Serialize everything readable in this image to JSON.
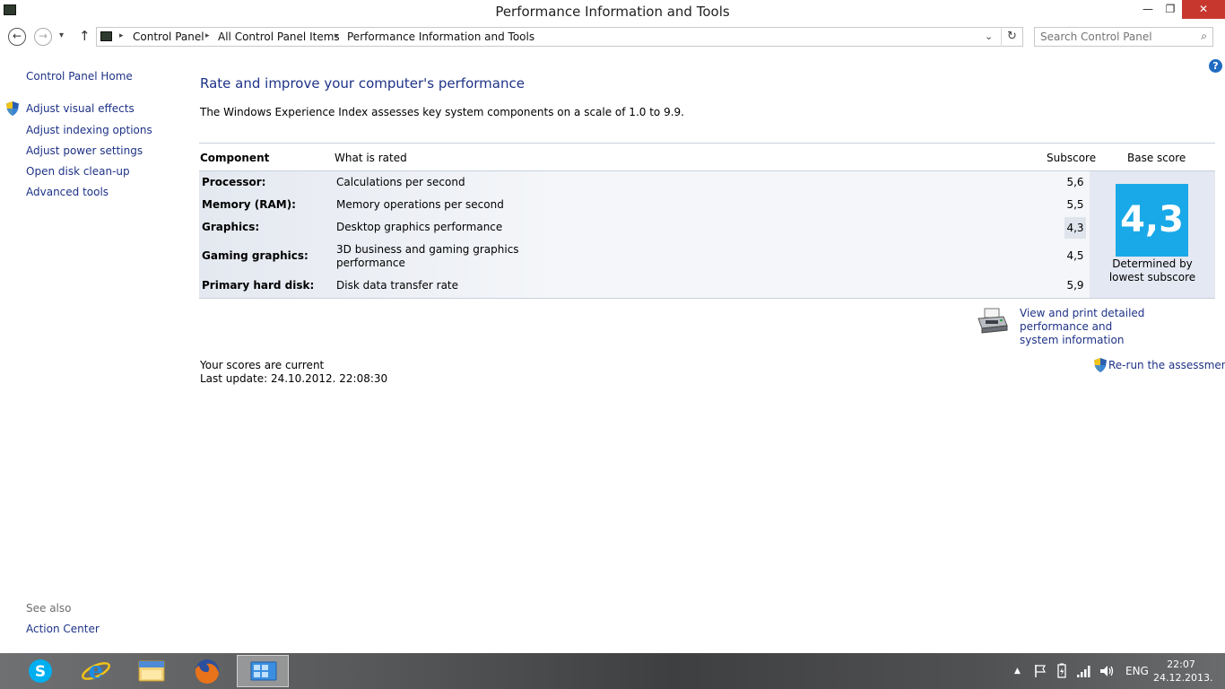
{
  "window": {
    "title": "Performance Information and Tools",
    "minimize_label": "—",
    "maximize_label": "❐",
    "close_label": "✕"
  },
  "navigation": {
    "back_label": "←",
    "forward_label": "→",
    "recent_label": "▾",
    "up_label": "↑",
    "breadcrumbs": [
      "Control Panel",
      "All Control Panel Items",
      "Performance Information and Tools"
    ],
    "separator": "▸",
    "dropdown_label": "⌄",
    "refresh_label": "↻",
    "search_placeholder": "Search Control Panel",
    "search_icon_label": "⌕"
  },
  "help_label": "?",
  "sidebar": {
    "home": "Control Panel Home",
    "items": [
      "Adjust visual effects",
      "Adjust indexing options",
      "Adjust power settings",
      "Open disk clean-up",
      "Advanced tools"
    ],
    "see_also_heading": "See also",
    "see_also_items": [
      "Action Center"
    ]
  },
  "main": {
    "title": "Rate and improve your computer's performance",
    "description": "The Windows Experience Index assesses key system components on a scale of 1.0 to 9.9.",
    "table": {
      "headers": {
        "component": "Component",
        "what_is_rated": "What is rated",
        "subscore": "Subscore",
        "base_score": "Base score"
      },
      "rows": [
        {
          "component": "Processor:",
          "what": "Calculations per second",
          "what2": "",
          "subscore": "5,6"
        },
        {
          "component": "Memory (RAM):",
          "what": "Memory operations per second",
          "what2": "",
          "subscore": "5,5"
        },
        {
          "component": "Graphics:",
          "what": "Desktop graphics performance",
          "what2": "",
          "subscore": "4,3"
        },
        {
          "component": "Gaming graphics:",
          "what": "3D business and gaming graphics",
          "what2": "performance",
          "subscore": "4,5"
        },
        {
          "component": "Primary hard disk:",
          "what": "Disk data transfer rate",
          "what2": "",
          "subscore": "5,9"
        }
      ],
      "base_score": "4,3",
      "base_caption_line1": "Determined by",
      "base_caption_line2": "lowest subscore"
    },
    "print_link_line1": "View and print detailed performance and",
    "print_link_line2": "system information",
    "status_line1": "Your scores are current",
    "status_line2": "Last update: 24.10.2012. 22:08:30",
    "rerun_link": "Re-run the assessment"
  },
  "taskbar": {
    "apps": [
      "skype-icon",
      "internet-explorer-icon",
      "file-explorer-icon",
      "firefox-icon",
      "control-panel-icon"
    ],
    "tray": {
      "show_hidden": "▲",
      "language": "ENG",
      "time": "22:07",
      "date": "24.12.2013."
    }
  },
  "colors": {
    "link": "#1e3287",
    "base_tile": "#1aa9e8",
    "close_button": "#c7372e"
  }
}
